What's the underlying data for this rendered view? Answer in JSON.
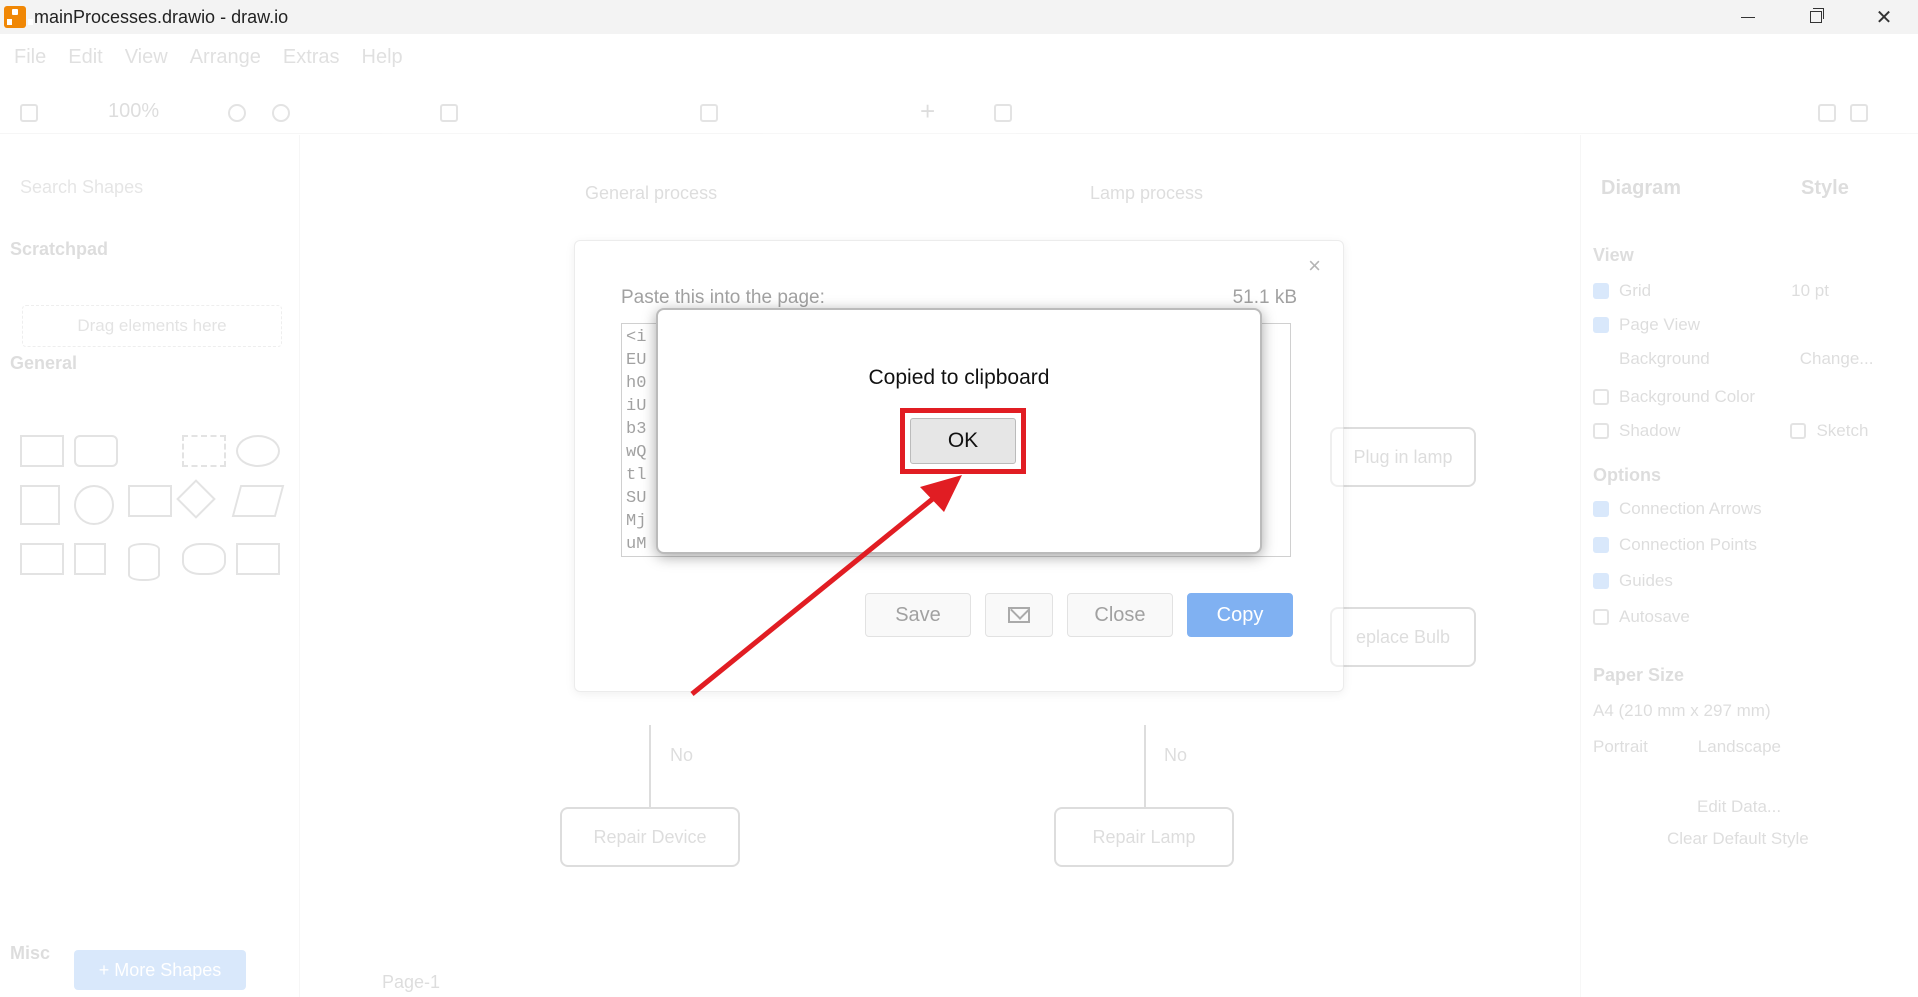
{
  "window": {
    "title": "mainProcesses.drawio - draw.io",
    "minimize_label": "",
    "maximize_label": "",
    "close_label": "✕"
  },
  "menu": [
    "File",
    "Edit",
    "View",
    "Arrange",
    "Extras",
    "Help"
  ],
  "toolbar": {
    "zoom": "100%"
  },
  "left_panel": {
    "search_placeholder": "Search Shapes",
    "scratchpad": "Scratchpad",
    "drop_hint": "Drag elements here",
    "general": "General",
    "misc": "Misc",
    "more_shapes": "+ More Shapes"
  },
  "canvas": {
    "lane1": "General process",
    "lane2": "Lamp process",
    "plug_in": "Plug in lamp",
    "replace_bulb": "eplace Bulb",
    "repair_device": "Repair Device",
    "repair_lamp": "Repair Lamp",
    "no1": "No",
    "no2": "No",
    "page_tab": "Page-1"
  },
  "right_panel": {
    "tab_diagram": "Diagram",
    "tab_style": "Style",
    "view_hdr": "View",
    "grid": "Grid",
    "grid_size": "10 pt",
    "page_view": "Page View",
    "background": "Background",
    "change": "Change...",
    "background_color": "Background Color",
    "shadow": "Shadow",
    "sketch": "Sketch",
    "options_hdr": "Options",
    "connection_arrows": "Connection Arrows",
    "connection_points": "Connection Points",
    "guides": "Guides",
    "autosave": "Autosave",
    "paper_size_hdr": "Paper Size",
    "paper_size": "A4 (210 mm x 297 mm)",
    "portrait": "Portrait",
    "landscape": "Landscape",
    "edit_data": "Edit Data...",
    "clear_style": "Clear Default Style"
  },
  "export_dialog": {
    "title": "Paste this into the page:",
    "size": "51.1 kB",
    "close_x": "×",
    "text_lines": [
      "<i",
      "EU",
      "h0",
      "iU",
      "b3",
      "wQ",
      "tl",
      "SU",
      "Mj",
      "uM"
    ],
    "save": "Save",
    "close": "Close",
    "copy": "Copy"
  },
  "alert": {
    "message": "Copied to clipboard",
    "ok": "OK"
  },
  "colors": {
    "highlight": "#e11d23",
    "accent": "#1a73e8",
    "logo": "#f08705"
  }
}
